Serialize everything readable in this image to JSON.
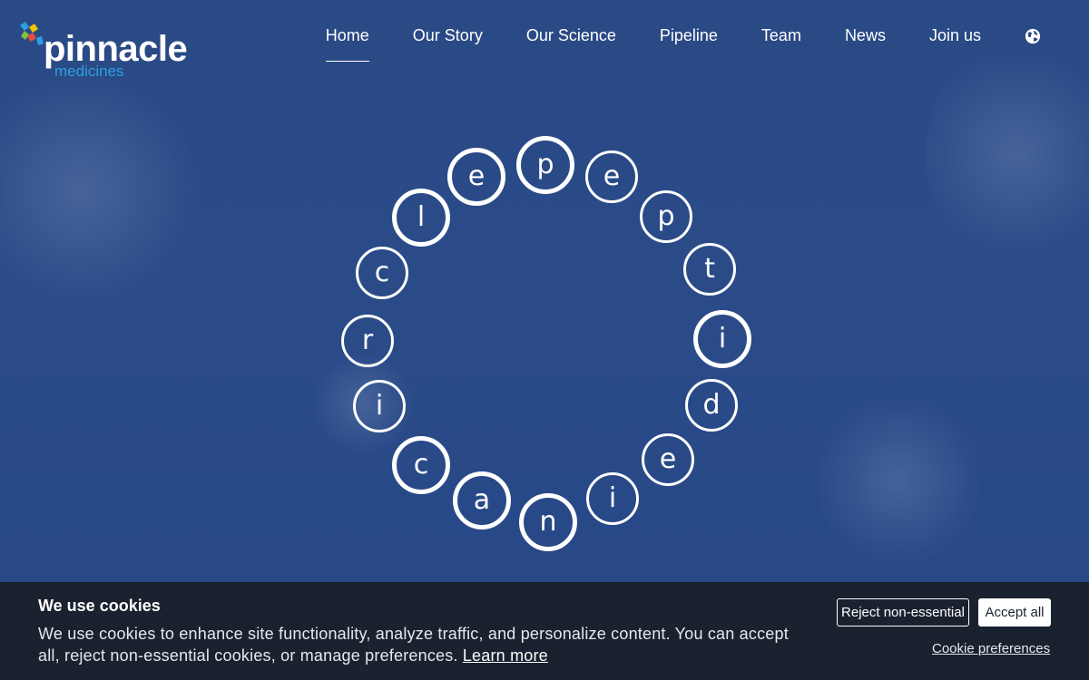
{
  "brand": {
    "name": "pinnacle",
    "sub": "medicines",
    "accent": "#2e9fe0"
  },
  "nav": {
    "items": [
      {
        "label": "Home",
        "active": true
      },
      {
        "label": "Our Story"
      },
      {
        "label": "Our Science"
      },
      {
        "label": "Pipeline"
      },
      {
        "label": "Team"
      },
      {
        "label": "News"
      },
      {
        "label": "Join us"
      }
    ],
    "language_icon": "globe-icon"
  },
  "hero": {
    "letters": [
      "p",
      "e",
      "p",
      "t",
      "i",
      "d",
      "e",
      "i",
      "n",
      "a",
      "c",
      "i",
      "r",
      "c",
      "l",
      "e"
    ]
  },
  "cookie": {
    "title": "We use cookies",
    "text": "We use cookies to enhance site functionality, analyze traffic, and personalize content. You can accept all, reject non-essential cookies, or manage preferences.",
    "learn_more": "Learn more",
    "reject_label": "Reject non-essential",
    "accept_label": "Accept all",
    "preferences_label": "Cookie preferences"
  }
}
